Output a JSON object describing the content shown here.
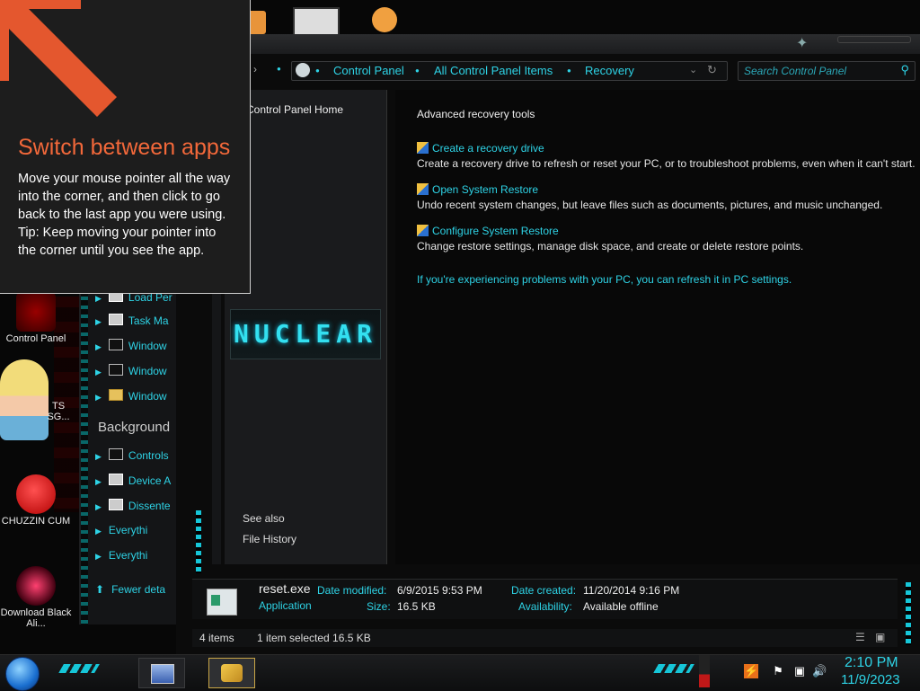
{
  "tip": {
    "title": "Switch between apps",
    "body": "Move your mouse pointer all the way into the corner, and then click to go back to the last app you were using.",
    "tip": "Tip: Keep moving your pointer into the corner until you see the app."
  },
  "desktop_icons": [
    {
      "label": "Control Panel"
    },
    {
      "label": "TS SG..."
    },
    {
      "label": "CHUZZIN CUM"
    },
    {
      "label": "Download Black Ali..."
    }
  ],
  "left_tree": {
    "items": [
      {
        "label": "Load Per",
        "icon": "app-icon"
      },
      {
        "label": "Task Ma",
        "icon": "app-icon"
      },
      {
        "label": "Window",
        "icon": "cmd-icon"
      },
      {
        "label": "Window",
        "icon": "cmd-icon"
      },
      {
        "label": "Window",
        "icon": "folder-icon"
      }
    ],
    "heading": "Background",
    "bg_items": [
      {
        "label": "Controls",
        "icon": "app-icon"
      },
      {
        "label": "Device A",
        "icon": "app-icon"
      },
      {
        "label": "Dissente",
        "icon": "app-icon"
      },
      {
        "label": "Everythi",
        "icon": "search-icon"
      },
      {
        "label": "Everythi",
        "icon": "search-icon"
      }
    ],
    "fewer": "Fewer deta"
  },
  "address": {
    "crumbs": [
      "Control Panel",
      "All Control Panel Items",
      "Recovery"
    ],
    "search_placeholder": "Search Control Panel"
  },
  "nav": {
    "home": "Control Panel Home",
    "logo": "NUCLEAR",
    "see_also": "See also",
    "file_history": "File History"
  },
  "content": {
    "heading": "Advanced recovery tools",
    "tasks": [
      {
        "link": "Create a recovery drive",
        "desc": "Create a recovery drive to refresh or reset your PC, or to troubleshoot problems, even when it can't start."
      },
      {
        "link": "Open System Restore",
        "desc": "Undo recent system changes, but leave files such as documents, pictures, and music unchanged."
      },
      {
        "link": "Configure System Restore",
        "desc": "Change restore settings, manage disk space, and create or delete restore points."
      }
    ],
    "refresh_link": "If you're experiencing problems with your PC, you can refresh it in PC settings."
  },
  "details": {
    "name": "reset.exe",
    "type": "Application",
    "date_modified_label": "Date modified:",
    "date_modified": "6/9/2015 9:53 PM",
    "size_label": "Size:",
    "size": "16.5 KB",
    "date_created_label": "Date created:",
    "date_created": "11/20/2014 9:16 PM",
    "availability_label": "Availability:",
    "availability": "Available offline"
  },
  "status": {
    "items": "4 items",
    "selected": "1 item selected  16.5 KB"
  },
  "clock": {
    "time": "2:10 PM",
    "date": "11/9/2023"
  },
  "colors": {
    "accent": "#2ed3e6",
    "tip_title": "#f2683a"
  }
}
